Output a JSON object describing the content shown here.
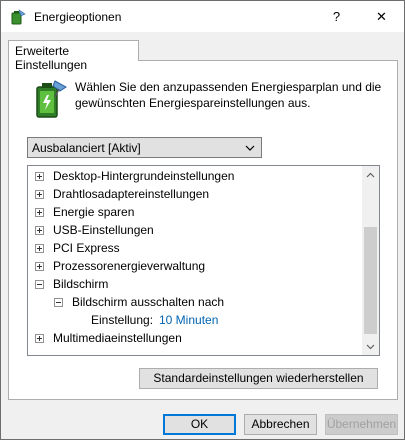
{
  "window": {
    "title": "Energieoptionen",
    "help_label": "?",
    "close_label": "✕"
  },
  "tab": {
    "label": "Erweiterte Einstellungen"
  },
  "description": "Wählen Sie den anzupassenden Energiesparplan und die gewünschten Energiespareinstellungen aus.",
  "plan_select": {
    "value": "Ausbalanciert [Aktiv]"
  },
  "tree": {
    "items": [
      {
        "label": "Desktop-Hintergrundeinstellungen",
        "expander": "+"
      },
      {
        "label": "Drahtlosadaptereinstellungen",
        "expander": "+"
      },
      {
        "label": "Energie sparen",
        "expander": "+"
      },
      {
        "label": "USB-Einstellungen",
        "expander": "+"
      },
      {
        "label": "PCI Express",
        "expander": "+"
      },
      {
        "label": "Prozessorenergieverwaltung",
        "expander": "+"
      },
      {
        "label": "Bildschirm",
        "expander": "-"
      },
      {
        "label": "Bildschirm ausschalten nach",
        "expander": "-"
      },
      {
        "label": "Einstellung:",
        "value": "10 Minuten"
      },
      {
        "label": "Multimediaeinstellungen",
        "expander": "+"
      }
    ]
  },
  "buttons": {
    "restore": "Standardeinstellungen wiederherstellen",
    "ok": "OK",
    "cancel": "Abbrechen",
    "apply": "Übernehmen"
  },
  "colors": {
    "accent": "#0078d7",
    "setting_value": "#0063b1"
  }
}
